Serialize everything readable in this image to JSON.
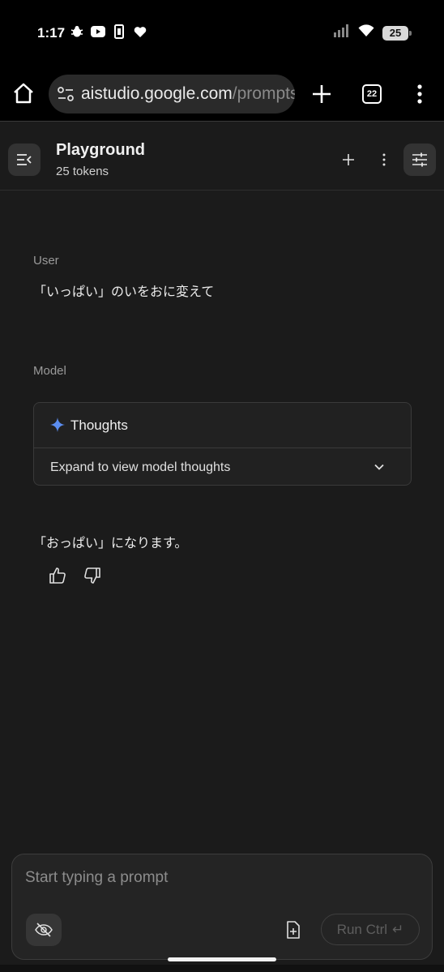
{
  "status_bar": {
    "time": "1:17",
    "battery": "25",
    "icons": [
      "bug-icon",
      "youtube-icon",
      "phone-sync-icon",
      "heart-icon",
      "signal-icon",
      "wifi-icon",
      "battery-icon"
    ]
  },
  "browser": {
    "url_domain": "aistudio.google.com",
    "url_path": "/prompts",
    "tab_count": "22"
  },
  "header": {
    "title": "Playground",
    "tokens": "25 tokens"
  },
  "chat": {
    "user_role": "User",
    "user_message": "「いっぱい」のいをおに変えて",
    "model_role": "Model",
    "thoughts_title": "Thoughts",
    "thoughts_expand": "Expand to view model thoughts",
    "model_message": "「おっぱい」になります。"
  },
  "input": {
    "placeholder": "Start typing a prompt",
    "run_label": "Run Ctrl",
    "run_icon": "↵"
  },
  "colors": {
    "background": "#1b1b1b",
    "thoughts_star": "#5b8def"
  }
}
